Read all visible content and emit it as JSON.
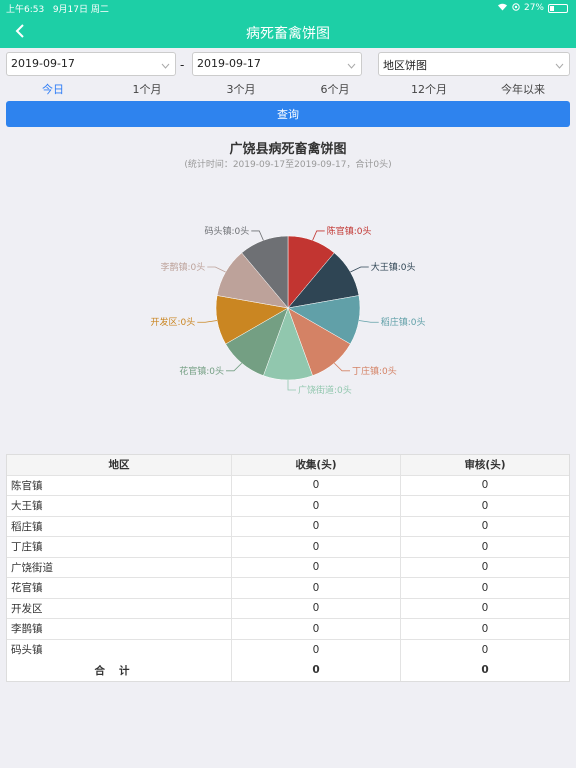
{
  "status_bar": {
    "time": "上午6:53",
    "date": "9月17日 周二",
    "battery": "27%",
    "battery_level": 0.27
  },
  "nav": {
    "title": "病死畜禽饼图"
  },
  "filters": {
    "start_date": "2019-09-17",
    "end_date": "2019-09-17",
    "chart_type": "地区饼图",
    "separator": "-"
  },
  "tabs": [
    {
      "label": "今日",
      "active": true
    },
    {
      "label": "1个月",
      "active": false
    },
    {
      "label": "3个月",
      "active": false
    },
    {
      "label": "6个月",
      "active": false
    },
    {
      "label": "12个月",
      "active": false
    },
    {
      "label": "今年以来",
      "active": false
    }
  ],
  "query_label": "查询",
  "chart_data": {
    "type": "pie",
    "title": "广饶县病死畜禽饼图",
    "subtitle": "(统计时间：2019-09-17至2019-09-17，合计0头)",
    "slices": [
      {
        "name": "陈官镇",
        "label": "陈官镇:0头",
        "value": 0,
        "color": "#c23531"
      },
      {
        "name": "大王镇",
        "label": "大王镇:0头",
        "value": 0,
        "color": "#2f4554"
      },
      {
        "name": "稻庄镇",
        "label": "稻庄镇:0头",
        "value": 0,
        "color": "#61a0a8"
      },
      {
        "name": "丁庄镇",
        "label": "丁庄镇:0头",
        "value": 0,
        "color": "#d48265"
      },
      {
        "name": "广饶街道",
        "label": "广饶街道:0头",
        "value": 0,
        "color": "#91c7ae"
      },
      {
        "name": "花官镇",
        "label": "花官镇:0头",
        "value": 0,
        "color": "#749f83"
      },
      {
        "name": "开发区",
        "label": "开发区:0头",
        "value": 0,
        "color": "#ca8622"
      },
      {
        "name": "李鹊镇",
        "label": "李鹊镇:0头",
        "value": 0,
        "color": "#bda29a"
      },
      {
        "name": "码头镇",
        "label": "码头镇:0头",
        "value": 0,
        "color": "#6e7074"
      }
    ]
  },
  "table": {
    "headers": [
      "地区",
      "收集(头)",
      "审核(头)"
    ],
    "rows": [
      [
        "陈官镇",
        "0",
        "0"
      ],
      [
        "大王镇",
        "0",
        "0"
      ],
      [
        "稻庄镇",
        "0",
        "0"
      ],
      [
        "丁庄镇",
        "0",
        "0"
      ],
      [
        "广饶街道",
        "0",
        "0"
      ],
      [
        "花官镇",
        "0",
        "0"
      ],
      [
        "开发区",
        "0",
        "0"
      ],
      [
        "李鹊镇",
        "0",
        "0"
      ],
      [
        "码头镇",
        "0",
        "0"
      ]
    ],
    "total": [
      "合计",
      "0",
      "0"
    ]
  }
}
